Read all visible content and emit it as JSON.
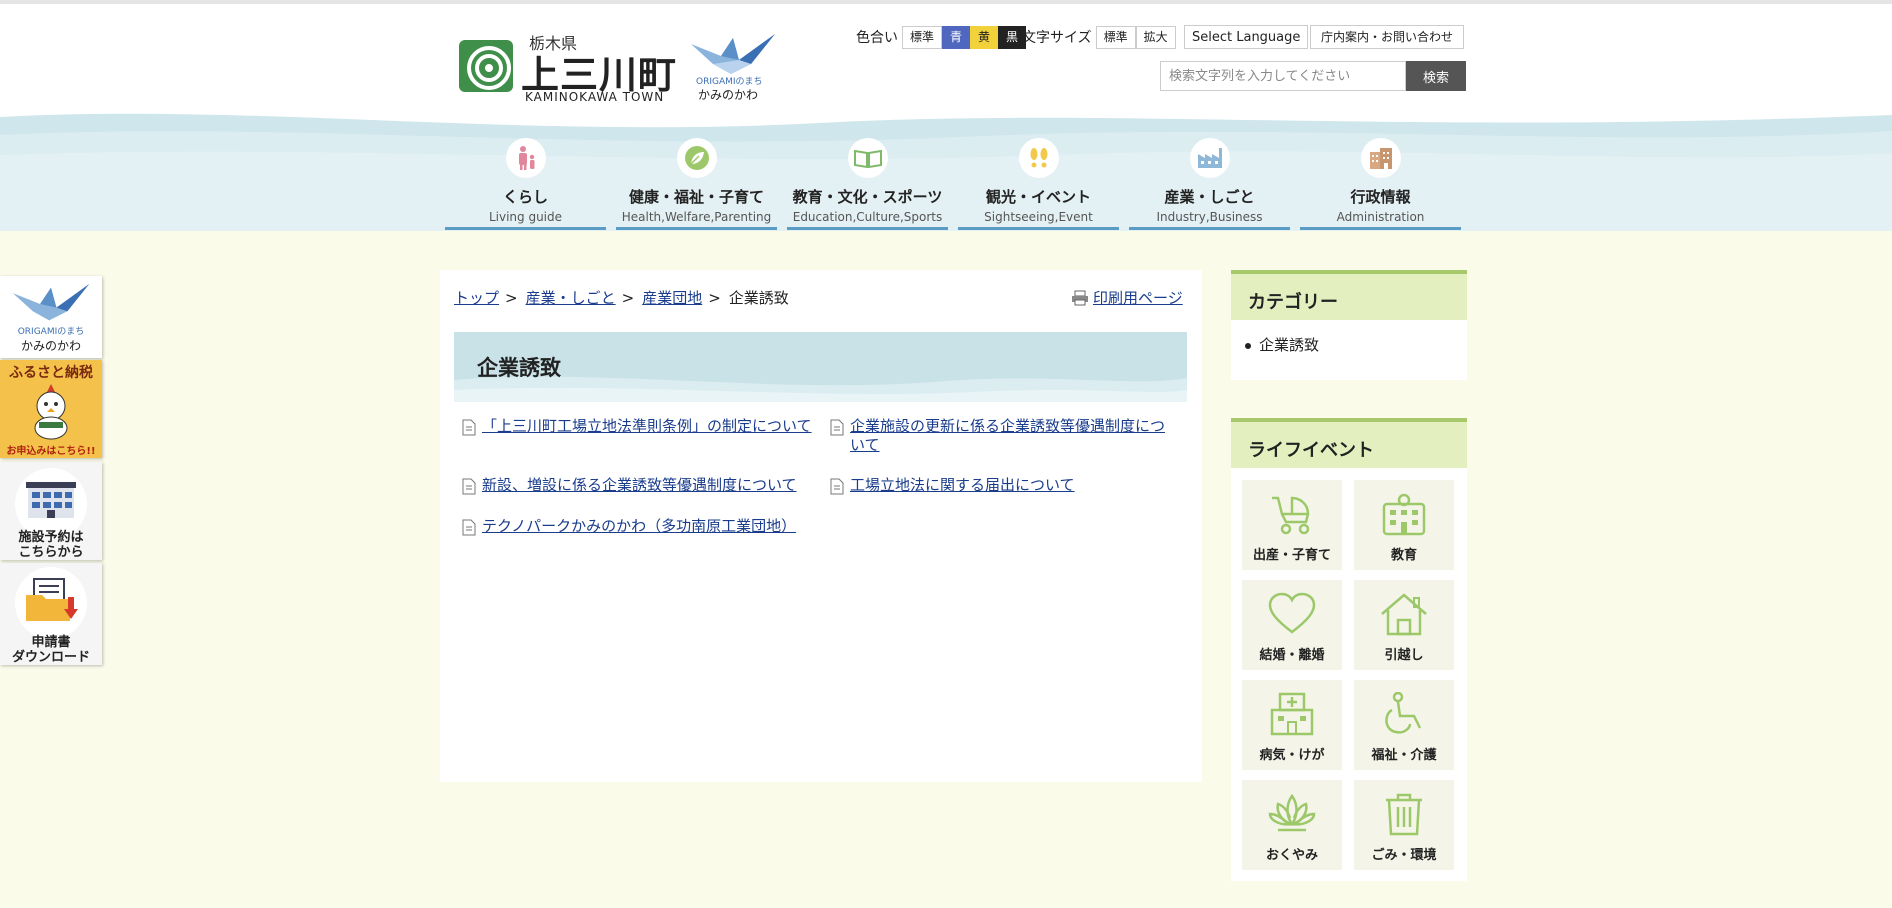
{
  "header": {
    "prefecture": "栃木県",
    "town_name": "上三川町",
    "town_roman": "KAMINOKAWA TOWN",
    "origami_label": "ORIGAMIのまち",
    "origami_kana": "かみのかわ"
  },
  "tools": {
    "color_label": "色合い",
    "color_options": [
      "標準",
      "青",
      "黄",
      "黒"
    ],
    "size_label": "文字サイズ",
    "size_options": [
      "標準",
      "拡大"
    ],
    "language_button": "Select Language",
    "contact_button": "庁内案内・お問い合わせ"
  },
  "search": {
    "placeholder": "検索文字列を入力してください",
    "button": "検索"
  },
  "global_nav": [
    {
      "ja": "くらし",
      "en": "Living guide",
      "icon": "person-child-icon"
    },
    {
      "ja": "健康・福祉・子育て",
      "en": "Health,Welfare,Parenting",
      "icon": "leaf-icon"
    },
    {
      "ja": "教育・文化・スポーツ",
      "en": "Education,Culture,Sports",
      "icon": "book-icon"
    },
    {
      "ja": "観光・イベント",
      "en": "Sightseeing,Event",
      "icon": "footprints-icon"
    },
    {
      "ja": "産業・しごと",
      "en": "Industry,Business",
      "icon": "factory-icon"
    },
    {
      "ja": "行政情報",
      "en": "Administration",
      "icon": "building-icon"
    }
  ],
  "side_banners": {
    "origami": {
      "line1": "ORIGAMIのまち",
      "line2": "かみのかわ"
    },
    "furusato": {
      "title": "ふるさと納税",
      "sub": "お申込みはこちら!!"
    },
    "facility": {
      "line1": "施設予約は",
      "line2": "こちらから"
    },
    "download": {
      "line1": "申請書",
      "line2": "ダウンロード"
    }
  },
  "breadcrumb": {
    "items": [
      "トップ",
      "産業・しごと",
      "産業団地"
    ],
    "current": "企業誘致"
  },
  "print_link": "印刷用ページ",
  "page_title": "企業誘致",
  "documents": [
    "「上三川町工場立地法準則条例」の制定について",
    "企業施設の更新に係る企業誘致等優遇制度について",
    "新設、増設に係る企業誘致等優遇制度について",
    "工場立地法に関する届出について",
    "テクノパークかみのかわ（多功南原工業団地）"
  ],
  "category": {
    "heading": "カテゴリー",
    "items": [
      "企業誘致"
    ]
  },
  "life_events": {
    "heading": "ライフイベント",
    "items": [
      {
        "label": "出産・子育て",
        "icon": "stroller-icon"
      },
      {
        "label": "教育",
        "icon": "school-icon"
      },
      {
        "label": "結婚・離婚",
        "icon": "heart-icon"
      },
      {
        "label": "引越し",
        "icon": "house-icon"
      },
      {
        "label": "病気・けが",
        "icon": "hospital-icon"
      },
      {
        "label": "福祉・介護",
        "icon": "wheelchair-icon"
      },
      {
        "label": "おくやみ",
        "icon": "lotus-icon"
      },
      {
        "label": "ごみ・環境",
        "icon": "trash-icon"
      }
    ]
  },
  "colors": {
    "accent_green": "#a7c96b",
    "nav_blue": "#5a9cc4",
    "link": "#1a3c8c",
    "background": "#fbfbea"
  }
}
